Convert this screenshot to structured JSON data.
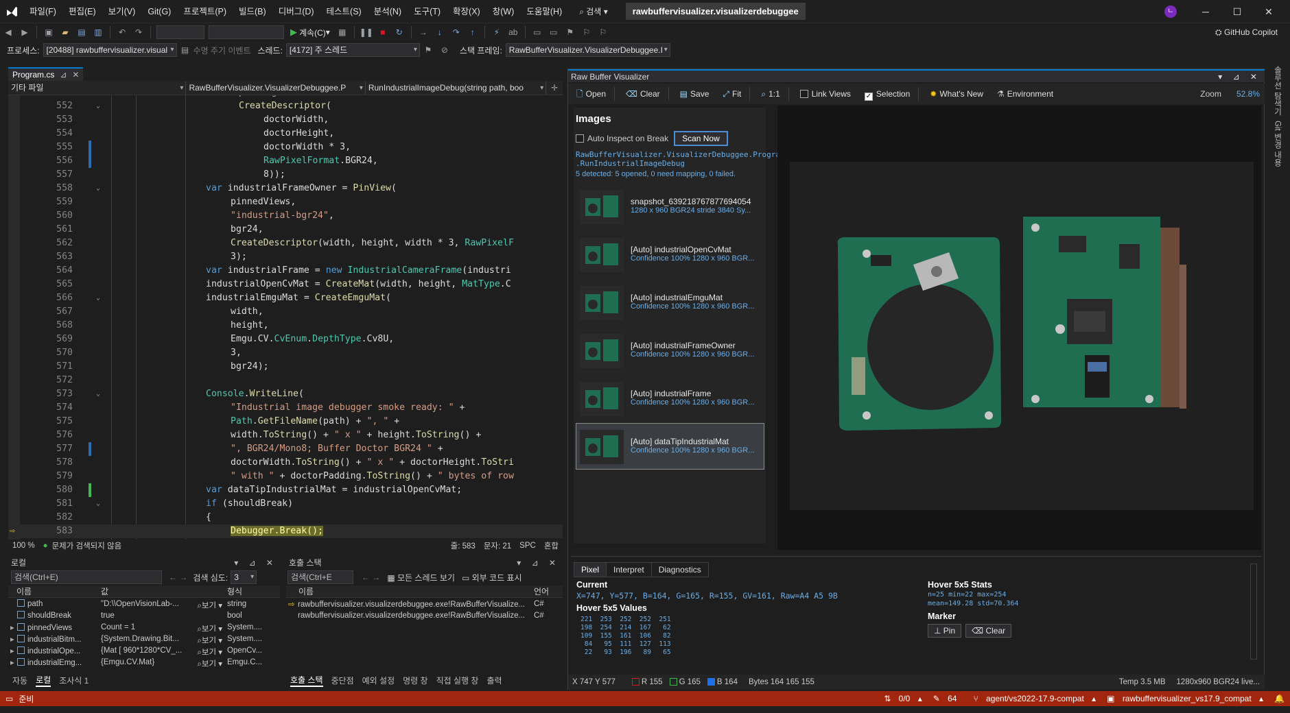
{
  "title": {
    "menus": [
      "파일(F)",
      "편집(E)",
      "보기(V)",
      "Git(G)",
      "프로젝트(P)",
      "빌드(B)",
      "디버그(D)",
      "테스트(S)",
      "분석(N)",
      "도구(T)",
      "확장(X)",
      "창(W)",
      "도움말(H)"
    ],
    "search": "검색",
    "solution": "rawbuffervisualizer.visualizerdebuggee",
    "avatar": "ㄴ"
  },
  "toolbar": {
    "continue_label": "계속(C)",
    "copilot": "GitHub Copilot"
  },
  "debugbar": {
    "process_label": "프로세스:",
    "process_value": "[20488] rawbuffervisualizer.visual",
    "lifecycle_label": "수명 주기 이벤트",
    "thread_label": "스레드:",
    "thread_value": "[4172] 주 스레드",
    "stackframe_label": "스택 프레임:",
    "stackframe_value": "RawBufferVisualizer.VisualizerDebuggee.I"
  },
  "editor": {
    "tab": "Program.cs",
    "nav_project": "기타 파일",
    "nav_class": "RawBufferVisualizer.VisualizerDebuggee.P",
    "nav_method": "RunIndustrialImageDebug(string path, boo",
    "zoom": "100 %",
    "issues": "문제가 검색되지 않음",
    "line": "줄: 583",
    "col": "문자: 21",
    "spc": "SPC",
    "crlf": "혼합"
  },
  "locals": {
    "title": "로컬",
    "search": "검색(Ctrl+E)",
    "depth_label": "검색 심도:",
    "depth": "3",
    "columns": [
      "이름",
      "값",
      "형식"
    ],
    "rows": [
      {
        "name": "path",
        "value": "\"D:\\\\OpenVisionLab-...",
        "view": "보기",
        "type": "string"
      },
      {
        "name": "shouldBreak",
        "value": "true",
        "view": "",
        "type": "bool"
      },
      {
        "name": "pinnedViews",
        "value": "Count = 1",
        "view": "보기",
        "type": "System...."
      },
      {
        "name": "industrialBitm...",
        "value": "{System.Drawing.Bit...",
        "view": "보기",
        "type": "System...."
      },
      {
        "name": "industrialOpe...",
        "value": "{Mat [ 960*1280*CV_...",
        "view": "보기",
        "type": "OpenCv..."
      },
      {
        "name": "industrialEmg...",
        "value": "{Emgu.CV.Mat}",
        "view": "보기",
        "type": "Emgu.C..."
      }
    ],
    "tabs": [
      "자동",
      "로컬",
      "조사식 1"
    ]
  },
  "callstack": {
    "title": "호출 스택",
    "search": "검색(Ctrl+E",
    "show_threads": "모든 스레드 보기",
    "external": "외부 코드 표시",
    "columns": [
      "이름",
      "언어"
    ],
    "rows": [
      {
        "name": "rawbuffervisualizer.visualizerdebuggee.exe!RawBufferVisualize...",
        "lang": "C#"
      },
      {
        "name": "rawbuffervisualizer.visualizerdebuggee.exe!RawBufferVisualize...",
        "lang": "C#"
      }
    ],
    "tabs": [
      "호출 스택",
      "중단점",
      "예외 설정",
      "명령 창",
      "직접 실행 창",
      "출력"
    ]
  },
  "rbv": {
    "title": "Raw Buffer Visualizer",
    "buttons": [
      "Open",
      "Clear",
      "Save",
      "Fit",
      "1:1"
    ],
    "link_views": "Link Views",
    "selection": "Selection",
    "whats_new": "What's New",
    "environment": "Environment",
    "zoom_label": "Zoom",
    "zoom_value": "52.8%",
    "images_title": "Images",
    "auto_inspect": "Auto Inspect on Break",
    "scan_now": "Scan Now",
    "context_line1": "RawBufferVisualizer.VisualizerDebuggee.Program",
    "context_line2": ".RunIndustrialImageDebug",
    "detected": "5 detected: 5 opened, 0 need mapping, 0 failed.",
    "items": [
      {
        "name": "snapshot_639218767877694054",
        "sub": "1280 x 960  BGR24  stride 3840  Sy..."
      },
      {
        "name": "[Auto] industrialOpenCvMat",
        "sub": "Confidence 100%  1280 x 960  BGR..."
      },
      {
        "name": "[Auto] industrialEmguMat",
        "sub": "Confidence 100%  1280 x 960  BGR..."
      },
      {
        "name": "[Auto] industrialFrameOwner",
        "sub": "Confidence 100%  1280 x 960  BGR..."
      },
      {
        "name": "[Auto] industrialFrame",
        "sub": "Confidence 100%  1280 x 960  BGR..."
      },
      {
        "name": "[Auto] dataTipIndustrialMat",
        "sub": "Confidence 100%  1280 x 960  BGR..."
      }
    ],
    "inspector_tabs": [
      "Pixel",
      "Interpret",
      "Diagnostics"
    ],
    "current_title": "Current",
    "current": "X=747, Y=577, B=164, G=165, R=155, GV=161, Raw=A4 A5 9B",
    "hover_values_title": "Hover 5x5 Values",
    "hover_values": [
      "221  253  252  252  251",
      "198  254  214  167   62",
      "109  155  161  106   82",
      " 84   95  111  127  113",
      " 22   93  196   89   65"
    ],
    "stats_title": "Hover 5x5 Stats",
    "stats_line1": "n=25  min=22  max=254",
    "stats_line2": "mean=149.28  std=70.364",
    "marker_title": "Marker",
    "pin": "Pin",
    "clear": "Clear",
    "status_xy": "X 747  Y 577",
    "status_r": "R 155",
    "status_g": "G 165",
    "status_b": "B 164",
    "status_bytes": "Bytes 164 165 155",
    "status_temp": "Temp 3.5 MB",
    "status_fmt": "1280x960 BGR24 live..."
  },
  "rightbar": [
    "솔루션 탐색기",
    "Git 변경 내용"
  ],
  "status": {
    "ready": "준비",
    "changes": "0/0",
    "edits": "64",
    "branch": "agent/vs2022-17.9-compat",
    "repo": "rawbuffervisualizer_vs17.9_compat"
  },
  "colors": {
    "accent": "#007acc",
    "status_bar": "#a1260d",
    "link_blue": "#6aaee8"
  }
}
